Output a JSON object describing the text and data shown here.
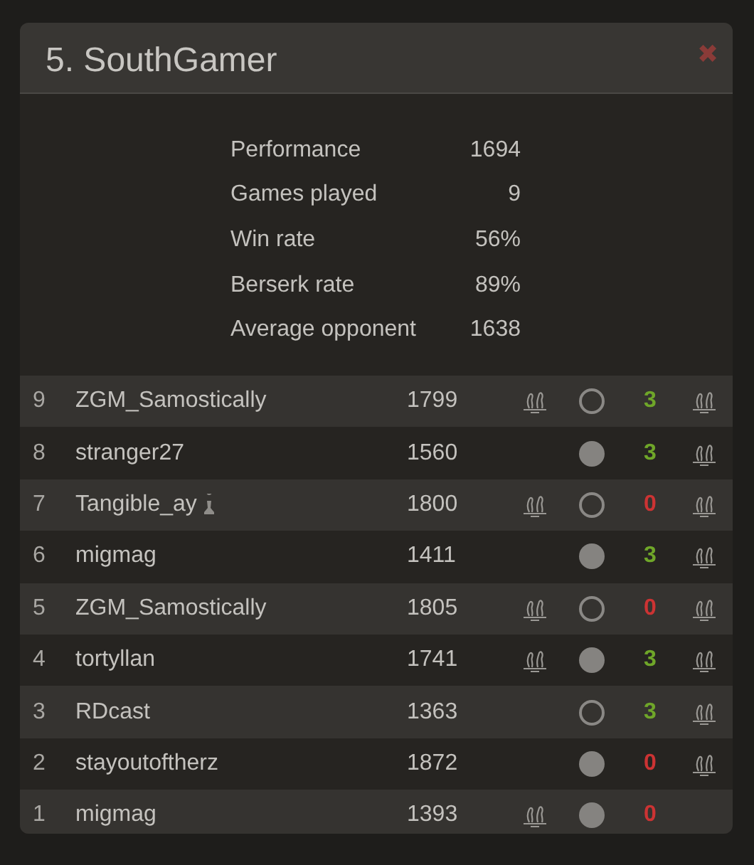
{
  "dialog": {
    "title": "5. SouthGamer",
    "close": "✖"
  },
  "stats": [
    {
      "label": "Performance",
      "value": "1694"
    },
    {
      "label": "Games played",
      "value": "9"
    },
    {
      "label": "Win rate",
      "value": "56%"
    },
    {
      "label": "Berserk rate",
      "value": "89%"
    },
    {
      "label": "Average opponent",
      "value": "1638"
    }
  ],
  "games": [
    {
      "rank": "9",
      "opponent": "ZGM_Samostically",
      "pawn": false,
      "rating": "1799",
      "opponent_berserk": true,
      "played_white": true,
      "score": "3",
      "won": true,
      "berserk": true
    },
    {
      "rank": "8",
      "opponent": "stranger27",
      "pawn": false,
      "rating": "1560",
      "opponent_berserk": false,
      "played_white": false,
      "score": "3",
      "won": true,
      "berserk": true
    },
    {
      "rank": "7",
      "opponent": "Tangible_ay",
      "pawn": true,
      "rating": "1800",
      "opponent_berserk": true,
      "played_white": true,
      "score": "0",
      "won": false,
      "berserk": true
    },
    {
      "rank": "6",
      "opponent": "migmag",
      "pawn": false,
      "rating": "1411",
      "opponent_berserk": false,
      "played_white": false,
      "score": "3",
      "won": true,
      "berserk": true
    },
    {
      "rank": "5",
      "opponent": "ZGM_Samostically",
      "pawn": false,
      "rating": "1805",
      "opponent_berserk": true,
      "played_white": true,
      "score": "0",
      "won": false,
      "berserk": true
    },
    {
      "rank": "4",
      "opponent": "tortyllan",
      "pawn": false,
      "rating": "1741",
      "opponent_berserk": true,
      "played_white": false,
      "score": "3",
      "won": true,
      "berserk": true
    },
    {
      "rank": "3",
      "opponent": "RDcast",
      "pawn": false,
      "rating": "1363",
      "opponent_berserk": false,
      "played_white": true,
      "score": "3",
      "won": true,
      "berserk": true
    },
    {
      "rank": "2",
      "opponent": "stayoutoftherz",
      "pawn": false,
      "rating": "1872",
      "opponent_berserk": false,
      "played_white": false,
      "score": "0",
      "won": false,
      "berserk": true
    },
    {
      "rank": "1",
      "opponent": "migmag",
      "pawn": false,
      "rating": "1393",
      "opponent_berserk": true,
      "played_white": false,
      "score": "0",
      "won": false,
      "berserk": false
    }
  ]
}
